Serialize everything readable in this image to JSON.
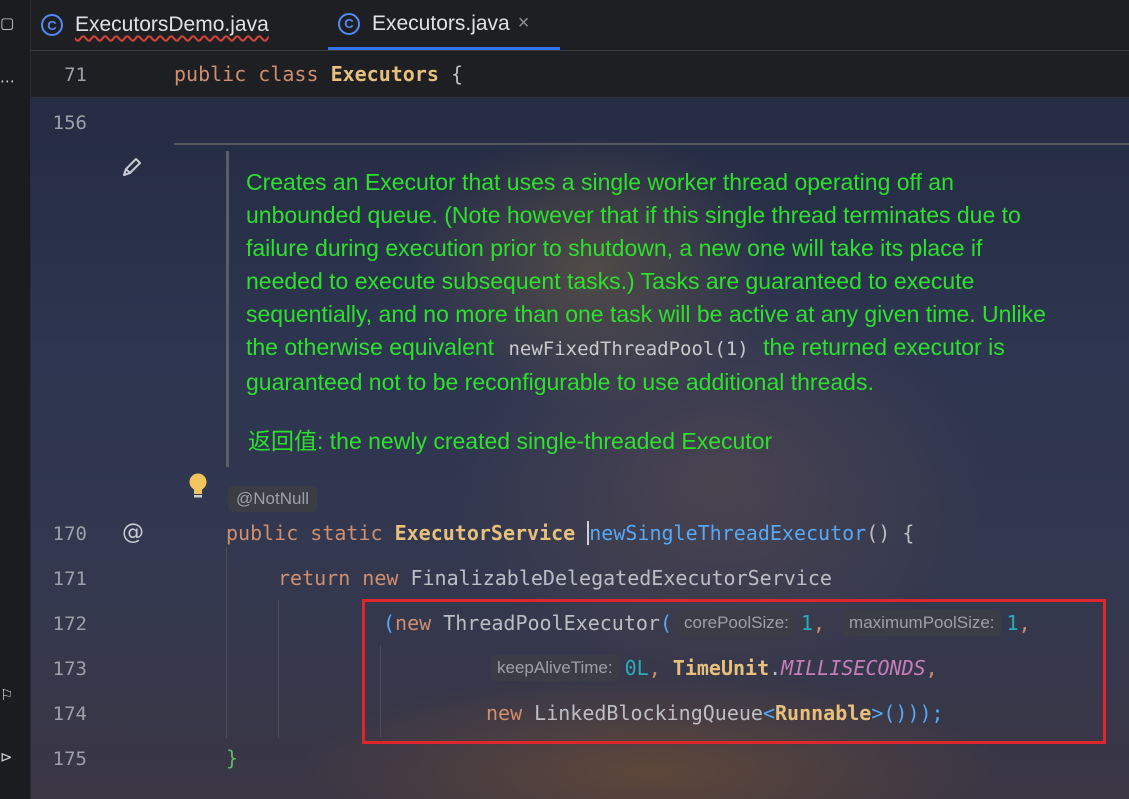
{
  "tabs": [
    {
      "label": "ExecutorsDemo.java",
      "icon": "java-class-run-icon",
      "active": false
    },
    {
      "label": "Executors.java",
      "icon": "java-class-icon",
      "active": true,
      "close_glyph": "×"
    }
  ],
  "sticky": {
    "line": "71",
    "kw_public": "public",
    "kw_class": "class",
    "class_name": "Executors",
    "brace": "{"
  },
  "gutter": {
    "line156": "156",
    "line170": "170",
    "line171": "171",
    "line172": "172",
    "line173": "173",
    "line174": "174",
    "line175": "175"
  },
  "doc": {
    "lines": [
      "Creates an Executor that uses a single worker thread operating off an",
      "unbounded queue. (Note however that if this single thread terminates due to",
      "failure during execution prior to shutdown, a new one will take its place if",
      "needed to execute subsequent tasks.) Tasks are guaranteed to execute",
      "sequentially, and no more than one task will be active at any given time. Unlike"
    ],
    "line6_before": "the otherwise equivalent",
    "line6_code": "newFixedThreadPool(1)",
    "line6_after": "the returned executor is",
    "line7": "guaranteed not to be reconfigurable to use additional threads.",
    "returns": "返回值: the newly created single-threaded Executor"
  },
  "annotation": "@NotNull",
  "code": {
    "l170": {
      "kw1": "public",
      "kw2": "static",
      "type": "ExecutorService",
      "method": "newSingleThreadExecutor",
      "rest": "() {"
    },
    "l171": {
      "kw1": "return",
      "kw2": "new",
      "type": "FinalizableDelegatedExecutorService"
    },
    "l172": {
      "open": "(",
      "kw": "new",
      "type": "ThreadPoolExecutor",
      "paren": "(",
      "hint1": "corePoolSize:",
      "v1": "1",
      "comma1": ",",
      "hint2": "maximumPoolSize:",
      "v2": "1",
      "comma2": ","
    },
    "l173": {
      "hint": "keepAliveTime:",
      "v": "0L",
      "comma": ",",
      "cls": "TimeUnit",
      "dot": ".",
      "const": "MILLISECONDS",
      "comma2": ","
    },
    "l174": {
      "kw": "new",
      "type": "LinkedBlockingQueue",
      "lt": "<",
      "generic": "Runnable",
      "gt": ">",
      "tail": "()));"
    },
    "l175": {
      "brace": "}"
    }
  }
}
